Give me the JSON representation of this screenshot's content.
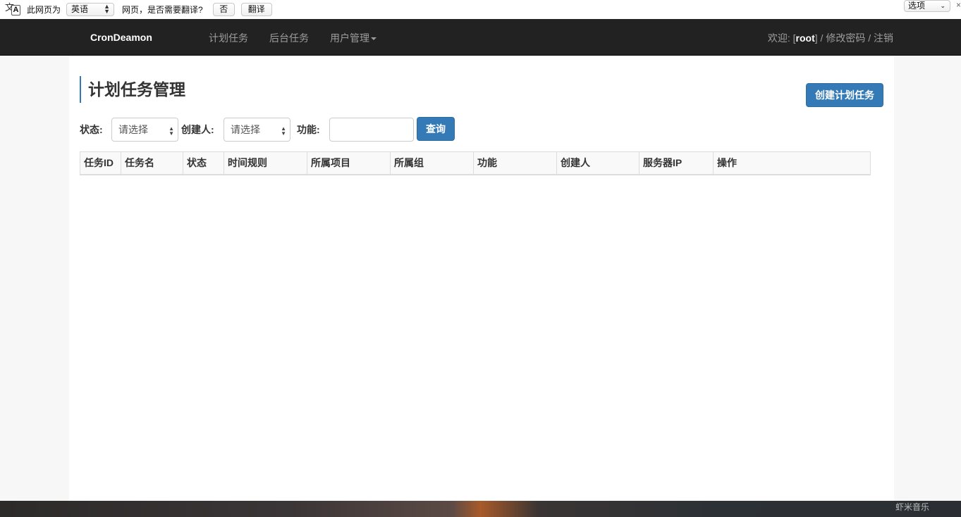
{
  "translate_bar": {
    "icon_top": "文",
    "icon_bottom": "A",
    "prefix": "此网页为",
    "language": "英语",
    "question": "网页，是否需要翻译?",
    "no_label": "否",
    "translate_label": "翻译",
    "options_label": "选项",
    "close_label": "×"
  },
  "navbar": {
    "brand": "CronDeamon",
    "items": [
      {
        "label": "计划任务"
      },
      {
        "label": "后台任务"
      },
      {
        "label": "用户管理"
      }
    ],
    "welcome_prefix": "欢迎: [",
    "username": "root",
    "welcome_suffix": "] / 修改密码 / 注销"
  },
  "page": {
    "title": "计划任务管理",
    "create_button": "创建计划任务"
  },
  "filters": {
    "status_label": "状态:",
    "status_value": "请选择",
    "creator_label": "创建人:",
    "creator_value": "请选择",
    "function_label": "功能:",
    "function_value": "",
    "query_button": "查询"
  },
  "table": {
    "columns": [
      "任务ID",
      "任务名",
      "状态",
      "时间规则",
      "所属项目",
      "所属组",
      "功能",
      "创建人",
      "服务器IP",
      "操作"
    ],
    "rows": []
  },
  "desktop": {
    "dock_text": "虾米音乐"
  }
}
